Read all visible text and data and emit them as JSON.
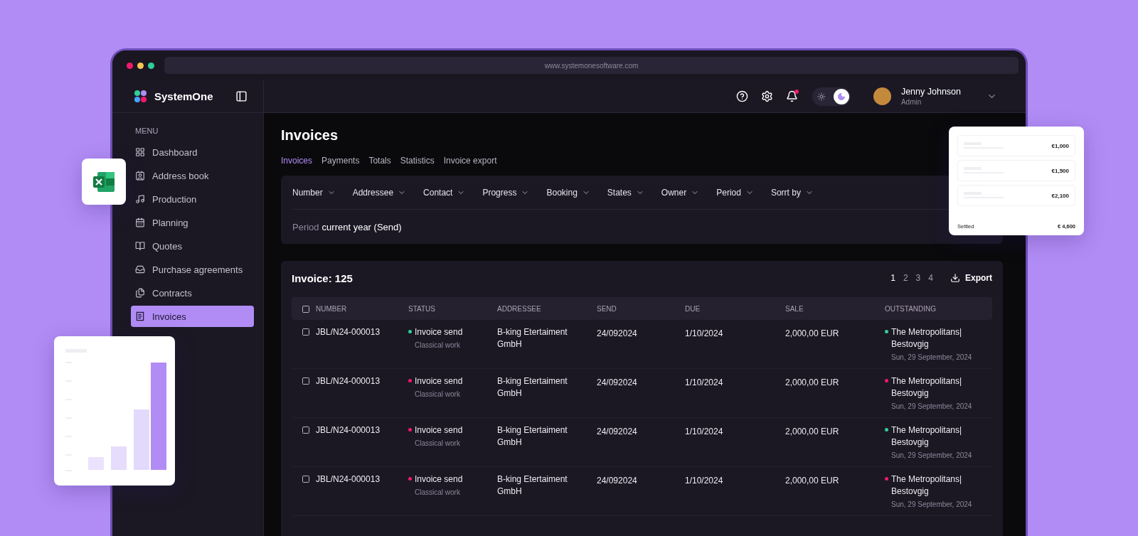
{
  "browser": {
    "url": "www.systemonesoftware.com"
  },
  "app": {
    "name": "SystemOne"
  },
  "sidebar": {
    "heading": "MENU",
    "items": [
      {
        "label": "Dashboard",
        "selected": false
      },
      {
        "label": "Address book",
        "selected": false
      },
      {
        "label": "Production",
        "selected": false
      },
      {
        "label": "Planning",
        "selected": false
      },
      {
        "label": "Quotes",
        "selected": false
      },
      {
        "label": "Purchase agreements",
        "selected": false
      },
      {
        "label": "Contracts",
        "selected": false
      },
      {
        "label": "Invoices",
        "selected": true
      }
    ]
  },
  "header": {
    "notifications_unread": true,
    "dark_mode": true,
    "user": {
      "name": "Jenny Johnson",
      "role": "Admin"
    }
  },
  "page": {
    "title": "Invoices",
    "tabs": [
      {
        "label": "Invoices",
        "selected": true
      },
      {
        "label": "Payments",
        "selected": false
      },
      {
        "label": "Totals",
        "selected": false
      },
      {
        "label": "Statistics",
        "selected": false
      },
      {
        "label": "Invoice export",
        "selected": false
      }
    ]
  },
  "filters": {
    "items": [
      "Number",
      "Addressee",
      "Contact",
      "Progress",
      "Booking",
      "States",
      "Owner",
      "Period",
      "Sorrt by"
    ],
    "active_label": "Period",
    "active_value": "current year (Send)"
  },
  "table": {
    "title": "Invoice: 125",
    "pages": [
      {
        "label": "1",
        "selected": true
      },
      {
        "label": "2",
        "selected": false
      },
      {
        "label": "3",
        "selected": false
      },
      {
        "label": "4",
        "selected": false
      }
    ],
    "export_label": "Export",
    "select_all_checked": false,
    "columns": [
      "NUMBER",
      "STATUS",
      "ADDRESSEE",
      "SEND",
      "DUE",
      "SALE",
      "OUTSTANDING"
    ],
    "rows": [
      {
        "checked": false,
        "number": "JBL/N24-000013",
        "status": {
          "label": "Invoice send",
          "color": "#2ecf9a",
          "note": "Classical work"
        },
        "addressee": "B-king Etertaiment GmbH",
        "send": "24/092024",
        "due": "1/10/2024",
        "sale": "2,000,00 EUR",
        "outstanding": {
          "name": "The Metropolitans| Bestovgig",
          "color": "#2ecf9a",
          "date": "Sun, 29 September, 2024"
        }
      },
      {
        "checked": false,
        "number": "JBL/N24-000013",
        "status": {
          "label": "Invoice send",
          "color": "#f0196a",
          "note": "Classical work"
        },
        "addressee": "B-king Etertaiment GmbH",
        "send": "24/092024",
        "due": "1/10/2024",
        "sale": "2,000,00 EUR",
        "outstanding": {
          "name": "The Metropolitans| Bestovgig",
          "color": "#f0196a",
          "date": "Sun, 29 September, 2024"
        }
      },
      {
        "checked": false,
        "number": "JBL/N24-000013",
        "status": {
          "label": "Invoice send",
          "color": "#f0196a",
          "note": "Classical work"
        },
        "addressee": "B-king Etertaiment GmbH",
        "send": "24/092024",
        "due": "1/10/2024",
        "sale": "2,000,00 EUR",
        "outstanding": {
          "name": "The Metropolitans| Bestovgig",
          "color": "#2ecf9a",
          "date": "Sun, 29 September, 2024"
        }
      },
      {
        "checked": false,
        "number": "JBL/N24-000013",
        "status": {
          "label": "Invoice send",
          "color": "#f0196a",
          "note": "Classical work"
        },
        "addressee": "B-king Etertaiment GmbH",
        "send": "24/092024",
        "due": "1/10/2024",
        "sale": "2,000,00 EUR",
        "outstanding": {
          "name": "The Metropolitans| Bestovgig",
          "color": "#f0196a",
          "date": "Sun, 29 September, 2024"
        }
      }
    ]
  },
  "payments_card": {
    "amounts": [
      "€1,000",
      "€1,500",
      "€2,100"
    ],
    "total_label": "Settled",
    "total_value": "€ 4,600"
  }
}
